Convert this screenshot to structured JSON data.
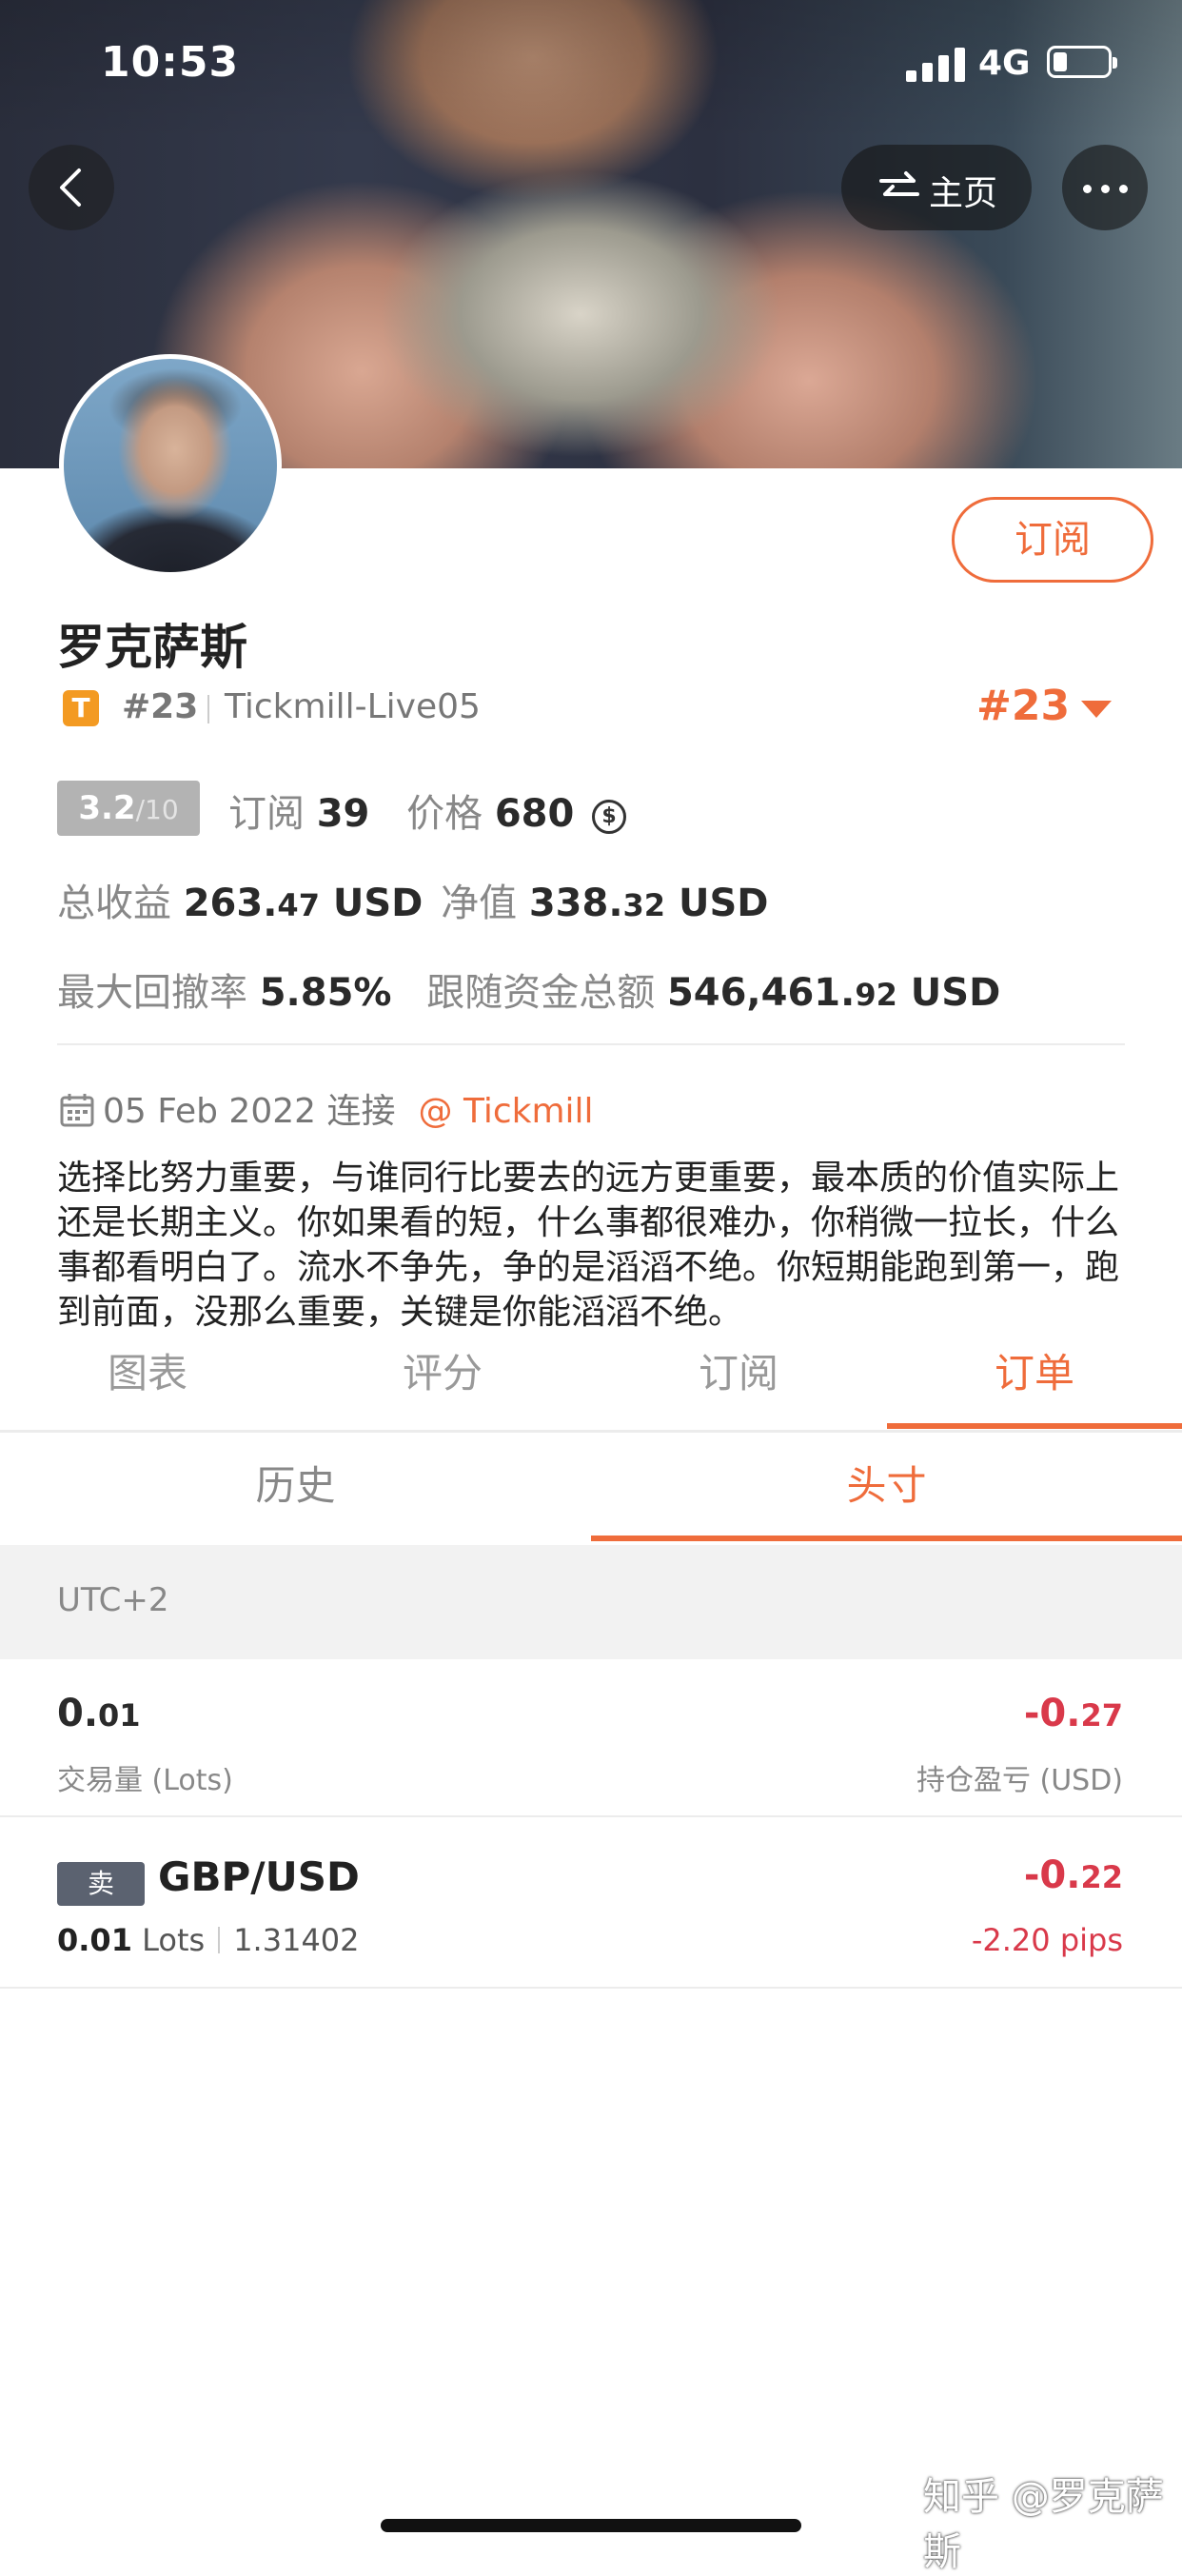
{
  "status_bar": {
    "time": "10:53",
    "network": "4G"
  },
  "nav": {
    "home_label": "主页"
  },
  "profile": {
    "subscribe_label": "订阅",
    "name": "罗克萨斯",
    "broker_badge": "T",
    "rank": "#23",
    "server": "Tickmill-Live05",
    "rank_big": "#23",
    "score": "3.2",
    "score_denominator": "/10",
    "subscribers_label": "订阅",
    "subscribers": "39",
    "price_label": "价格",
    "price": "680",
    "coin_symbol": "$",
    "total_profit_label": "总收益",
    "total_profit_main": "263.",
    "total_profit_decimals": "47",
    "total_profit_unit": "USD",
    "equity_label": "净值",
    "equity_main": "338.",
    "equity_decimals": "32",
    "equity_unit": "USD",
    "max_drawdown_label": "最大回撤率",
    "max_drawdown": "5.85%",
    "follow_funds_label": "跟随资金总额",
    "follow_funds_main": "546,461.",
    "follow_funds_decimals": "92",
    "follow_funds_unit": "USD",
    "connected_date": "05 Feb 2022 连接",
    "broker_link": "@ Tickmill",
    "bio": "选择比努力重要，与谁同行比要去的远方更重要，最本质的价值实际上还是长期主义。你如果看的短，什么事都很难办，你稍微一拉长，什么事都看明白了。流水不争先，争的是滔滔不绝。你短期能跑到第一，跑到前面，没那么重要，关键是你能滔滔不绝。"
  },
  "tabs": [
    "图表",
    "评分",
    "订阅",
    "订单"
  ],
  "active_tab": "订单",
  "subtabs": [
    "历史",
    "头寸"
  ],
  "active_subtab": "头寸",
  "timezone": "UTC+2",
  "summary": {
    "lots_main": "0.",
    "lots_decimals": "01",
    "lots_label": "交易量 (Lots)",
    "pnl_main": "-0.",
    "pnl_decimals": "27",
    "pnl_label": "持仓盈亏 (USD)"
  },
  "positions": [
    {
      "side": "卖",
      "symbol": "GBP/USD",
      "lots": "0.01",
      "lots_unit": "Lots",
      "open_price": "1.31402",
      "pnl_main": "-0.",
      "pnl_decimals": "22",
      "pips": "-2.20 pips"
    }
  ],
  "watermark": "知乎 @罗克萨斯",
  "colors": {
    "accent": "#ef6c3b",
    "loss": "#d9394a",
    "badge_orange": "#f39a22",
    "sell_badge": "#5b6270"
  }
}
